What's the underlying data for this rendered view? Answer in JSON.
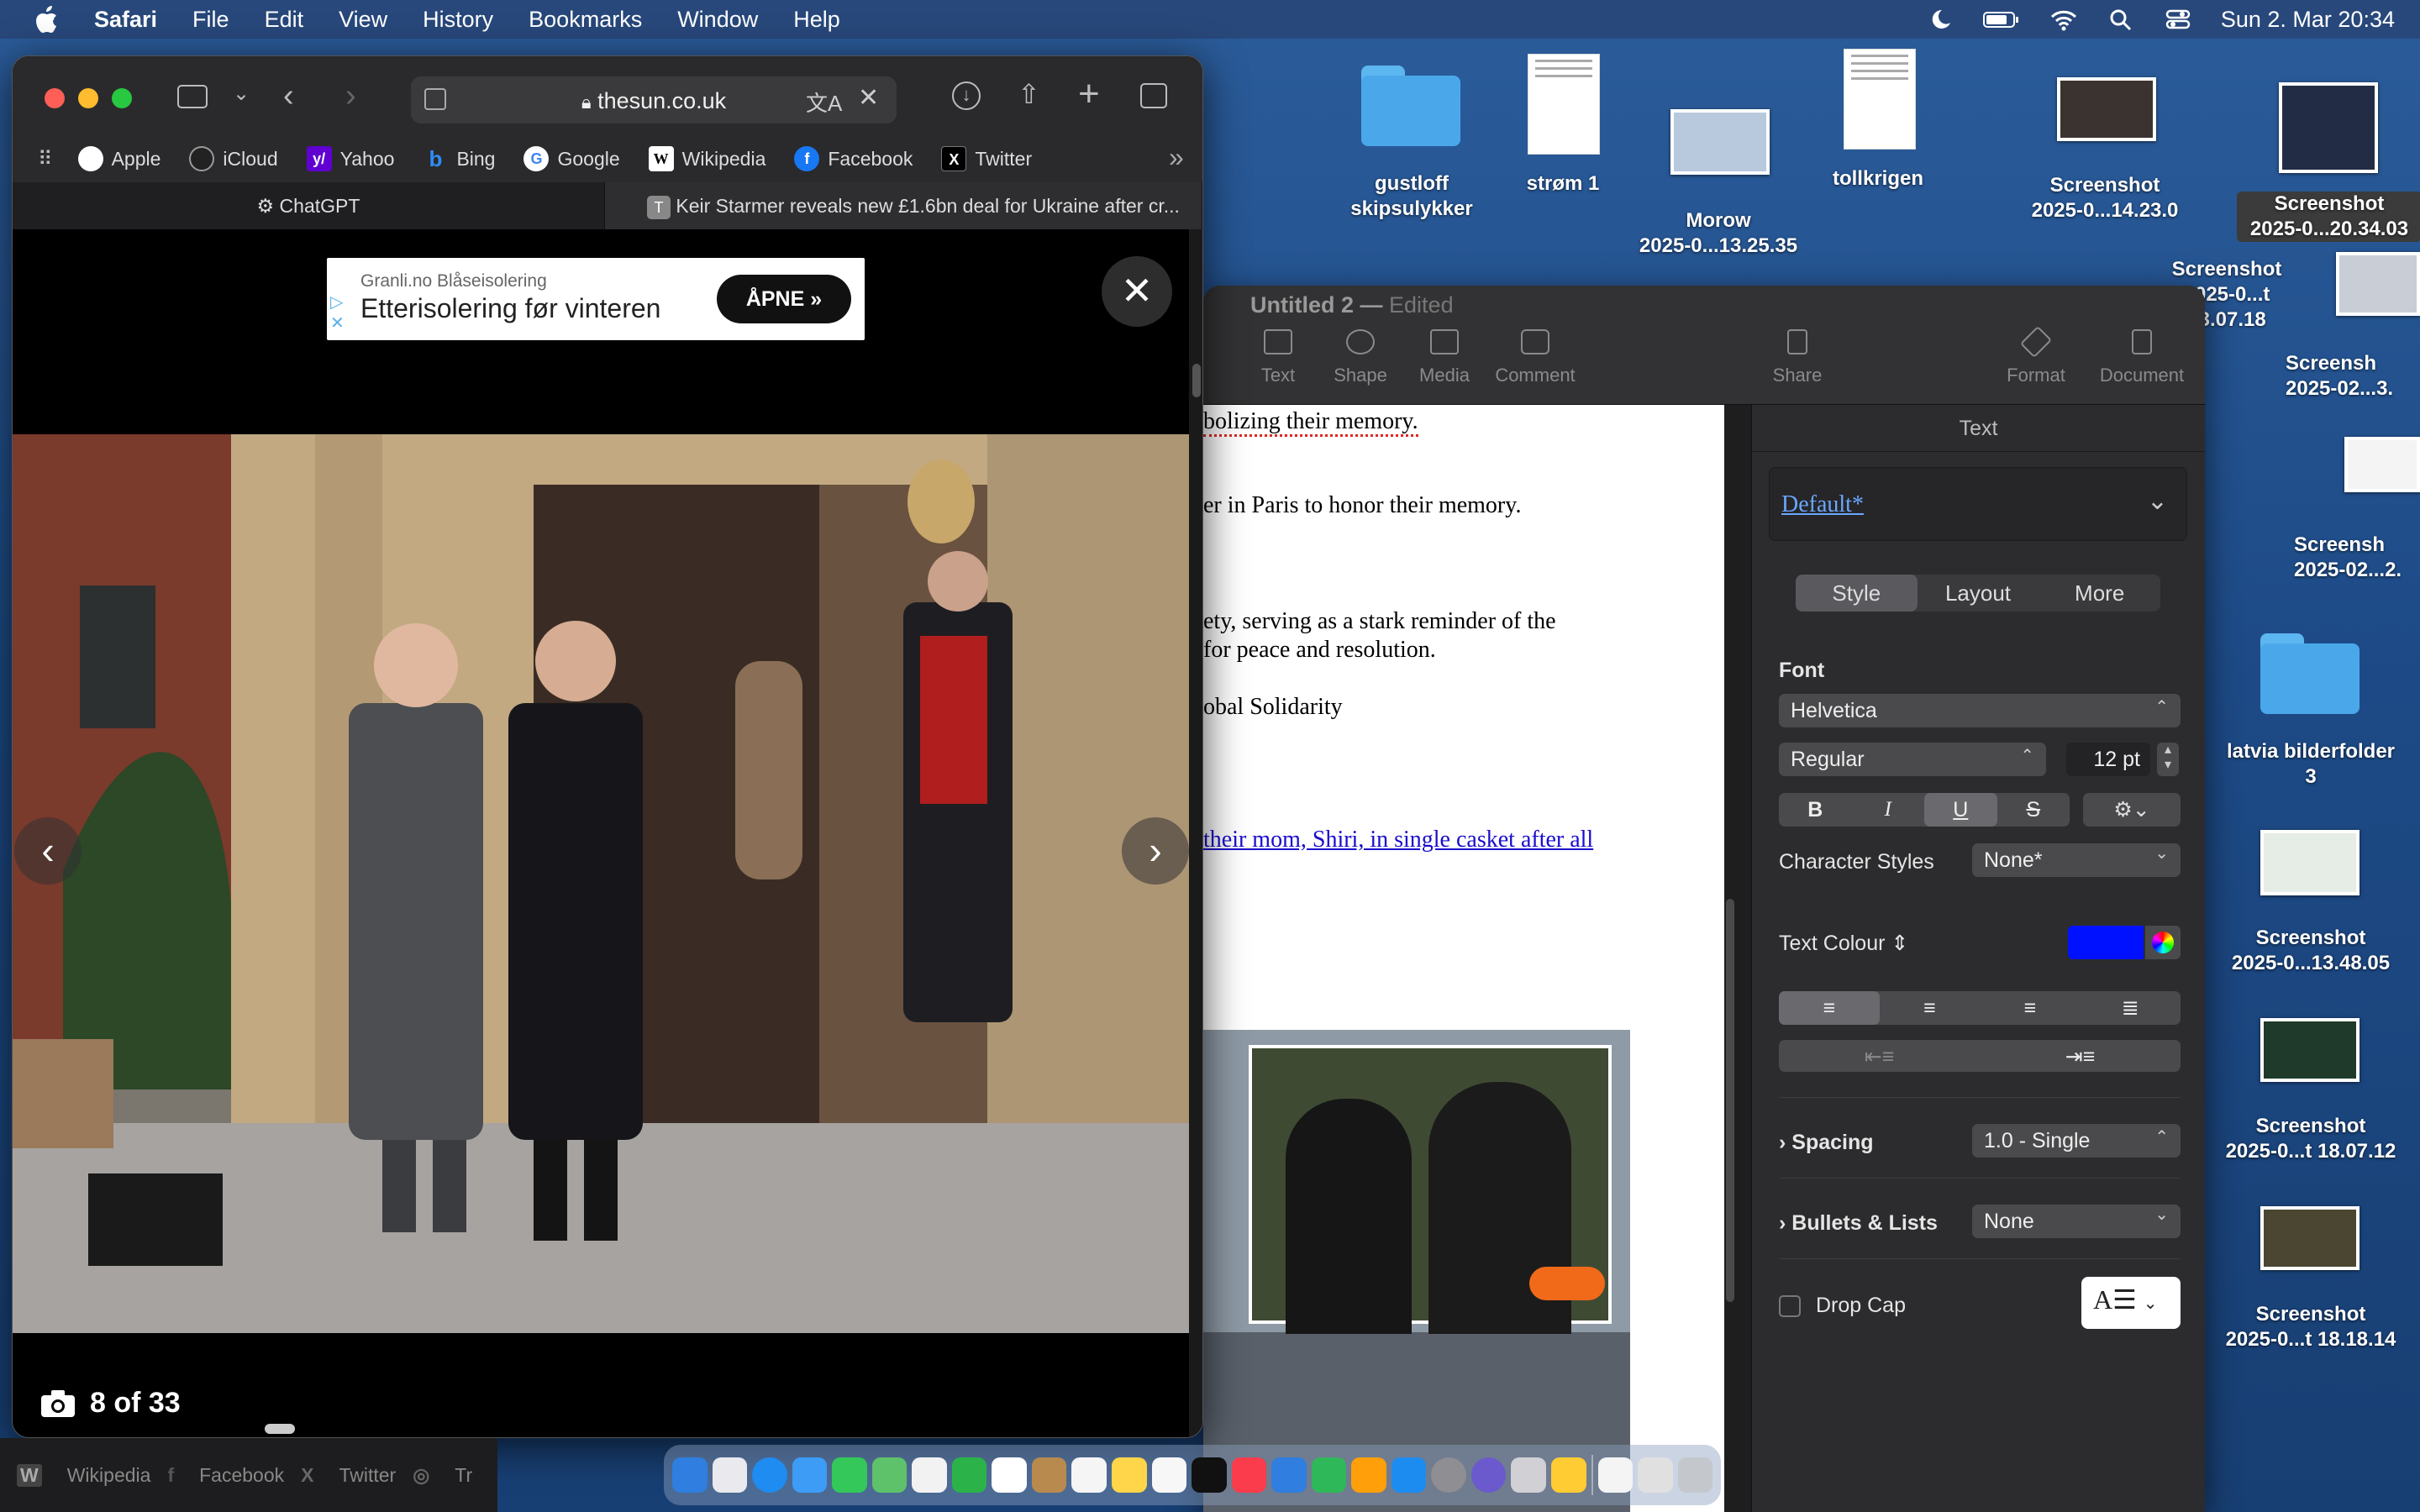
{
  "menubar": {
    "app": "Safari",
    "items": [
      "File",
      "Edit",
      "View",
      "History",
      "Bookmarks",
      "Window",
      "Help"
    ],
    "datetime": "Sun 2. Mar  20:34"
  },
  "desktop_icons": [
    {
      "label_line1": "gustloff",
      "label_line2": "skipsulykker",
      "kind": "folder"
    },
    {
      "label_line1": "strøm 1",
      "label_line2": "",
      "kind": "doc"
    },
    {
      "label_line1": "Morow",
      "label_line2": "2025-0...13.25.35",
      "kind": "thumb"
    },
    {
      "label_line1": "tollkrigen",
      "label_line2": "",
      "kind": "doc"
    },
    {
      "label_line1": "Screenshot",
      "label_line2": "2025-0...14.23.0",
      "kind": "thumb"
    },
    {
      "label_line1": "Screenshot",
      "label_line2": "2025-0...20.34.03",
      "kind": "thumb"
    },
    {
      "label_line1": "Screenshot",
      "label_line2": "2025-0...t 23.07.18",
      "kind": "thumb"
    },
    {
      "label_line1": "Screensh",
      "label_line2": "2025-02...3.",
      "kind": "thumb"
    },
    {
      "label_line1": "Screensh",
      "label_line2": "2025-02...2.",
      "kind": "thumb"
    },
    {
      "label_line1": "latvia bilderfolder",
      "label_line2": "3",
      "kind": "folder"
    },
    {
      "label_line1": "Screenshot",
      "label_line2": "2025-0...13.48.05",
      "kind": "thumb"
    },
    {
      "label_line1": "Screenshot",
      "label_line2": "2025-0...t 18.07.12",
      "kind": "thumb"
    },
    {
      "label_line1": "Screenshot",
      "label_line2": "2025-0...t 18.18.14",
      "kind": "thumb"
    }
  ],
  "safari": {
    "url": "thesun.co.uk",
    "favorites": [
      "Apple",
      "iCloud",
      "Yahoo",
      "Bing",
      "Google",
      "Wikipedia",
      "Facebook",
      "Twitter"
    ],
    "tabs": [
      "ChatGPT",
      "Keir Starmer reveals new £1.6bn deal for Ukraine after cr..."
    ],
    "ad": {
      "sub": "Granli.no Blåseisolering",
      "main": "Etterisolering før vinteren",
      "button": "ÅPNE"
    },
    "gallery_counter": "8 of 33",
    "close_symbol": "✕"
  },
  "pages": {
    "title": "Untitled 2",
    "title_status": "Edited",
    "toolbar": [
      "Text",
      "Shape",
      "Media",
      "Comment",
      "Share",
      "Format",
      "Document"
    ],
    "doc_lines": [
      "bolizing their memory.",
      "er in Paris to honor their memory.",
      "ety, serving as a stark reminder of the",
      " for peace and resolution.",
      "obal Solidarity",
      "their mom, Shiri, in single casket after all"
    ],
    "inspector": {
      "header": "Text",
      "paragraph_style": "Default*",
      "segments": [
        "Style",
        "Layout",
        "More"
      ],
      "font_label": "Font",
      "font_family": "Helvetica",
      "font_weight": "Regular",
      "font_size": "12 pt",
      "format_buttons": [
        "B",
        "I",
        "U",
        "S"
      ],
      "character_styles_label": "Character Styles",
      "character_styles_value": "None*",
      "text_colour_label": "Text Colour",
      "text_colour": "#0011ff",
      "spacing_label": "Spacing",
      "spacing_value": "1.0 - Single",
      "bullets_label": "Bullets & Lists",
      "bullets_value": "None",
      "drop_cap_label": "Drop Cap"
    }
  },
  "bottom_strip": [
    "Wikipedia",
    "Facebook",
    "Twitter",
    "Tr"
  ]
}
